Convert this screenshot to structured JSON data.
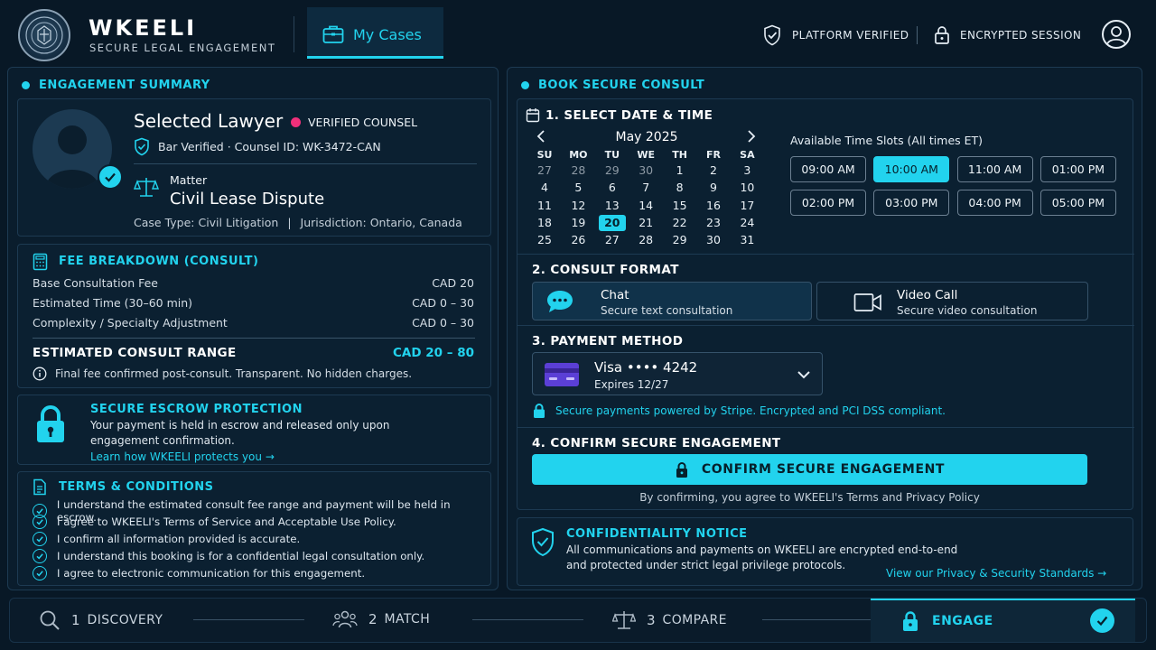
{
  "brand": {
    "name": "WKEELI",
    "tagline": "SECURE LEGAL ENGAGEMENT"
  },
  "header": {
    "tab_label": "My Cases",
    "platform_verified": "PLATFORM VERIFIED",
    "encrypted_session": "ENCRYPTED SESSION"
  },
  "summary": {
    "title": "ENGAGEMENT SUMMARY",
    "lawyer_name": "Selected Lawyer",
    "verified_label": "VERIFIED COUNSEL",
    "bar_line": "Bar Verified · Counsel ID: WK-3472-CAN",
    "matter_label": "Matter",
    "matter_title": "Civil Lease Dispute",
    "case_type": "Case Type: Civil Litigation",
    "jurisdiction": "Jurisdiction: Ontario, Canada"
  },
  "fees": {
    "title": "FEE BREAKDOWN (CONSULT)",
    "rows": [
      {
        "label": "Base Consultation Fee",
        "value": "CAD 20"
      },
      {
        "label": "Estimated Time (30–60 min)",
        "value": "CAD 0 – 30"
      },
      {
        "label": "Complexity / Specialty Adjustment",
        "value": "CAD 0 – 30"
      }
    ],
    "range_label": "ESTIMATED CONSULT RANGE",
    "range_value": "CAD 20 – 80",
    "note": "Final fee confirmed post-consult. Transparent. No hidden charges."
  },
  "escrow": {
    "title": "SECURE ESCROW PROTECTION",
    "line1": "Your payment is held in escrow and released only upon",
    "line2": "engagement confirmation.",
    "link": "Learn how WKEELI protects you →"
  },
  "terms": {
    "title": "TERMS & CONDITIONS",
    "items": [
      "I understand the estimated consult fee range and payment will be held in escrow.",
      "I agree to WKEELI's Terms of Service and Acceptable Use Policy.",
      "I confirm all information provided is accurate.",
      "I understand this booking is for a confidential legal consultation only.",
      "I agree to electronic communication for this engagement."
    ]
  },
  "booking": {
    "title": "BOOK SECURE CONSULT",
    "step1": "1. SELECT DATE & TIME",
    "month": "May 2025",
    "weekdays": [
      "SU",
      "MO",
      "TU",
      "WE",
      "TH",
      "FR",
      "SA"
    ],
    "weeks": [
      [
        "27",
        "28",
        "29",
        "30",
        "1",
        "2",
        "3"
      ],
      [
        "4",
        "5",
        "6",
        "7",
        "8",
        "9",
        "10"
      ],
      [
        "11",
        "12",
        "13",
        "14",
        "15",
        "16",
        "17"
      ],
      [
        "18",
        "19",
        "20",
        "21",
        "22",
        "23",
        "24"
      ],
      [
        "25",
        "26",
        "27",
        "28",
        "29",
        "30",
        "31"
      ]
    ],
    "selected_day": "20",
    "slots_label": "Available Time Slots (All times ET)",
    "slots": [
      "09:00 AM",
      "10:00 AM",
      "11:00 AM",
      "01:00 PM",
      "02:00 PM",
      "03:00 PM",
      "04:00 PM",
      "05:00 PM"
    ],
    "selected_slot": "10:00 AM",
    "step2": "2. CONSULT FORMAT",
    "chat_title": "Chat",
    "chat_sub": "Secure text consultation",
    "video_title": "Video Call",
    "video_sub": "Secure video consultation",
    "step3": "3. PAYMENT METHOD",
    "card_name": "Visa •••• 4242",
    "card_exp": "Expires 12/27",
    "stripe_note": "Secure payments powered by Stripe. Encrypted and PCI DSS compliant.",
    "step4": "4. CONFIRM SECURE ENGAGEMENT",
    "confirm_label": "CONFIRM SECURE ENGAGEMENT",
    "confirm_note": "By confirming, you agree to WKEELI's Terms and Privacy Policy"
  },
  "notice": {
    "title": "CONFIDENTIALITY NOTICE",
    "line1": "All communications and payments on WKEELI are encrypted end-to-end",
    "line2": "and protected under strict legal privilege protocols.",
    "link": "View our Privacy & Security Standards →"
  },
  "steps": {
    "s1_num": "1",
    "s1_label": "DISCOVERY",
    "s2_num": "2",
    "s2_label": "MATCH",
    "s3_num": "3",
    "s3_label": "COMPARE",
    "s4_label": "ENGAGE"
  },
  "colors": {
    "accent": "#22d3ee",
    "background": "#081826",
    "panel": "#0a1d2d",
    "verified_dot": "#f0307a"
  }
}
